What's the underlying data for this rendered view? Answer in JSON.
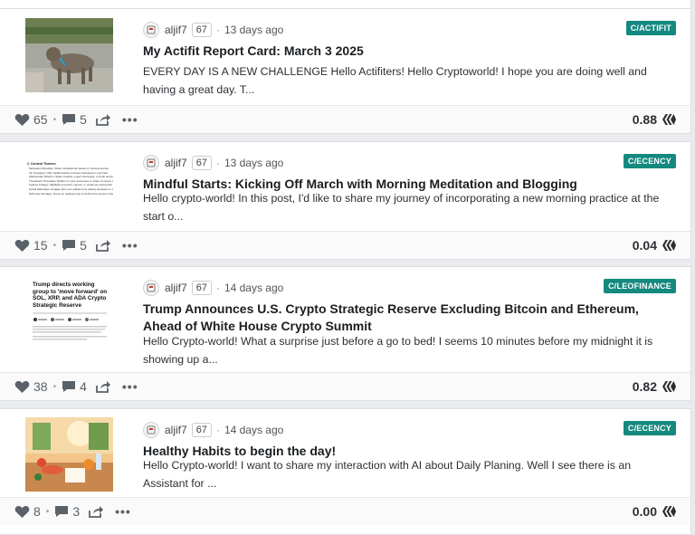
{
  "posts": [
    {
      "author": "aljif7",
      "reputation": "67",
      "time": "13 days ago",
      "community": "C/ACTIFIT",
      "title": "My Actifit Report Card: March 3 2025",
      "summary": "EVERY DAY IS A NEW CHALLENGE Hello Actifiters! Hello Cryptoworld! I hope you are doing well and having a great day. T...",
      "votes": "65",
      "comments": "5",
      "payout": "0.88"
    },
    {
      "author": "aljif7",
      "reputation": "67",
      "time": "13 days ago",
      "community": "C/ECENCY",
      "title": "Mindful Starts: Kicking Off March with Morning Meditation and Blogging",
      "summary": "Hello crypto-world! In this post, I'd like to share my journey of incorporating a new morning practice at the start o...",
      "votes": "15",
      "comments": "5",
      "payout": "0.04"
    },
    {
      "author": "aljif7",
      "reputation": "67",
      "time": "14 days ago",
      "community": "C/LEOFINANCE",
      "title": "Trump Announces U.S. Crypto Strategic Reserve Excluding Bitcoin and Ethereum, Ahead of White House Crypto Summit",
      "summary": "Hello Crypto-world! What a surprise just before a go to bed! I seems 10 minutes before my midnight it is showing up a...",
      "votes": "38",
      "comments": "4",
      "payout": "0.82",
      "thumb_text": "Trump directs working group to 'move forward' on SOL, XRP, and ADA Crypto Strategic Reserve"
    },
    {
      "author": "aljif7",
      "reputation": "67",
      "time": "14 days ago",
      "community": "C/ECENCY",
      "title": "Healthy Habits to begin the day!",
      "summary": "Hello Crypto-world! I want to share my interaction with AI about Daily Planing. Well I see there is an Assistant for ...",
      "votes": "8",
      "comments": "3",
      "payout": "0.00"
    }
  ],
  "thumb_list": {
    "heading": "2. Content Themes:",
    "lines": [
      "Motivation Mondays: Share inspirational quotes or success stories",
      "Tip Tuesdays: Offer helpful advice to those interested in your field",
      "Wednesday Wisdom: Share insights, expert interviews, or book recommendations",
      "Throwback Thursdays: Reflect on your successes or share company history",
      "Feature Fridays: Highlight a product, service, or customer testimonial",
      "Social Saturdays: Engage with your audience by asking questions or hosting a poll",
      "Self-Care Sundays: Focus on wellness tips or behind the scenes content"
    ]
  },
  "colors": {
    "tag": "#14897f",
    "background": "#e9ebee"
  },
  "icons": [
    "heart-icon",
    "comment-icon",
    "share-icon",
    "more-icon",
    "hive-icon",
    "avatar-icon"
  ]
}
